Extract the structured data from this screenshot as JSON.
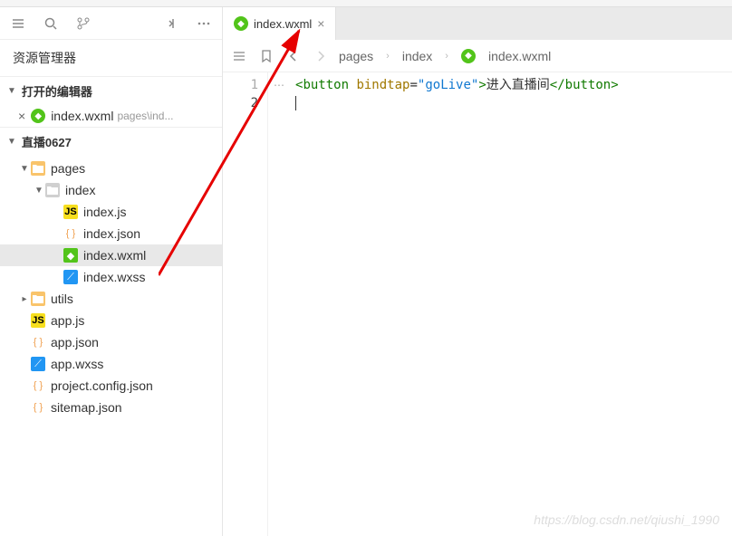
{
  "explorer": {
    "title": "资源管理器"
  },
  "sections": {
    "open_editors": {
      "label": "打开的编辑器",
      "items": [
        {
          "name": "index.wxml",
          "path": "pages\\ind..."
        }
      ]
    },
    "project": {
      "label": "直播0627"
    }
  },
  "tree": [
    {
      "type": "folder",
      "name": "pages",
      "depth": 1,
      "expanded": true,
      "iconClass": "icon-folder"
    },
    {
      "type": "folder",
      "name": "index",
      "depth": 2,
      "expanded": true,
      "iconClass": "icon-folder-open"
    },
    {
      "type": "file",
      "name": "index.js",
      "depth": 3,
      "iconClass": "icon-js",
      "iconText": "JS"
    },
    {
      "type": "file",
      "name": "index.json",
      "depth": 3,
      "iconClass": "icon-json",
      "iconText": "{ }"
    },
    {
      "type": "file",
      "name": "index.wxml",
      "depth": 3,
      "iconClass": "icon-wxml",
      "iconText": "◆",
      "selected": true
    },
    {
      "type": "file",
      "name": "index.wxss",
      "depth": 3,
      "iconClass": "icon-wxss",
      "iconText": "⟋"
    },
    {
      "type": "folder",
      "name": "utils",
      "depth": 1,
      "expanded": false,
      "iconClass": "icon-folder"
    },
    {
      "type": "file",
      "name": "app.js",
      "depth": 1,
      "iconClass": "icon-js",
      "iconText": "JS"
    },
    {
      "type": "file",
      "name": "app.json",
      "depth": 1,
      "iconClass": "icon-json",
      "iconText": "{ }"
    },
    {
      "type": "file",
      "name": "app.wxss",
      "depth": 1,
      "iconClass": "icon-wxss",
      "iconText": "⟋"
    },
    {
      "type": "file",
      "name": "project.config.json",
      "depth": 1,
      "iconClass": "icon-json",
      "iconText": "{ }"
    },
    {
      "type": "file",
      "name": "sitemap.json",
      "depth": 1,
      "iconClass": "icon-json",
      "iconText": "{ }"
    }
  ],
  "tab": {
    "name": "index.wxml"
  },
  "breadcrumbs": {
    "p1": "pages",
    "p2": "index",
    "p3": "index.wxml"
  },
  "code": {
    "line1": {
      "t1": "<",
      "t2": "button",
      "t3": " ",
      "t4": "bindtap",
      "t5": "=",
      "t6": "\"goLive\"",
      "t7": ">",
      "t8": "进入直播间",
      "t9": "</",
      "t10": "button",
      "t11": ">"
    },
    "lineNumbers": {
      "l1": "1",
      "l2": "2"
    }
  },
  "watermark": "https://blog.csdn.net/qiushi_1990"
}
